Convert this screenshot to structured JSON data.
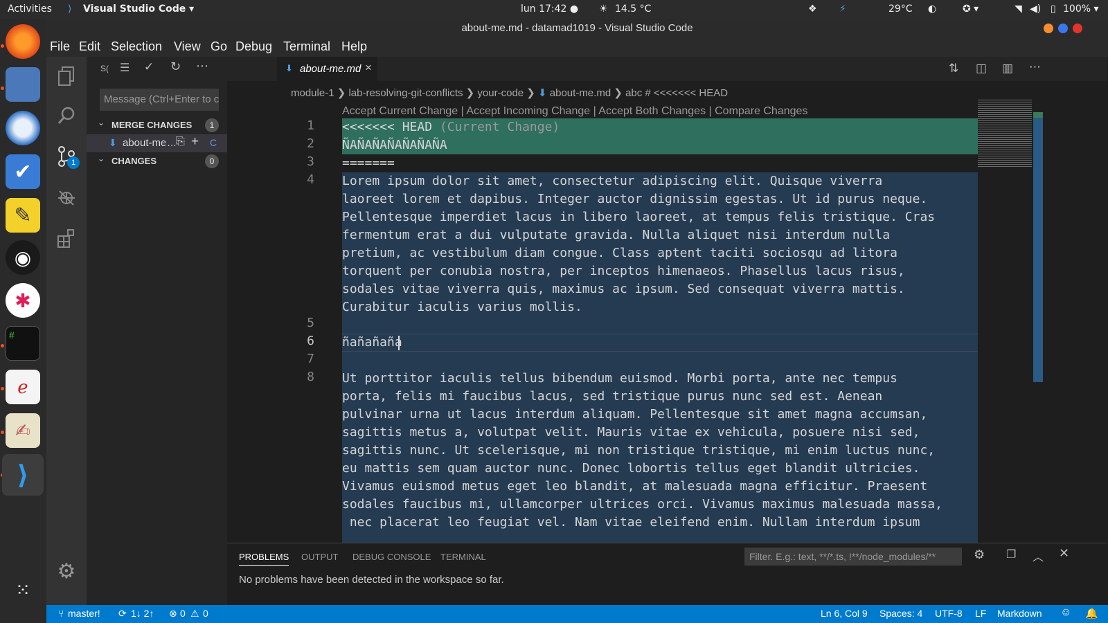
{
  "topbar": {
    "activities": "Activities",
    "app": "Visual Studio Code ▾",
    "clock": "lun 17:42 ●",
    "weather": "14.5 °C",
    "temp": "29°C",
    "battery": "100% ▾"
  },
  "window": {
    "title": "about-me.md - datamad1019 - Visual Studio Code"
  },
  "menu": [
    "File",
    "Edit",
    "Selection",
    "View",
    "Go",
    "Debug",
    "Terminal",
    "Help"
  ],
  "sidebar": {
    "header_abbrev": "S(",
    "commit_placeholder": "Message (Ctrl+Enter to commit)",
    "merge_section": "MERGE CHANGES",
    "merge_count": "1",
    "merge_file": "about-me.md",
    "merge_status": "C",
    "changes_section": "CHANGES",
    "changes_count": "0",
    "badge": "1"
  },
  "tab": {
    "label": "about-me.md"
  },
  "breadcrumb": [
    "module-1",
    "lab-resolving-git-conflicts",
    "your-code",
    "about-me.md",
    "abc # <<<<<<< HEAD"
  ],
  "codelens": "Accept Current Change | Accept Incoming Change | Accept Both Changes | Compare Changes",
  "line_numbers": [
    "1",
    "2",
    "3",
    "4",
    "5",
    "6",
    "7",
    "8"
  ],
  "code": {
    "l1_head": "<<<<<<< HEAD",
    "l1_tag": " (Current Change)",
    "l2": "ÑAÑAÑAÑAÑAÑAÑA",
    "l3": "=======",
    "l4": "Lorem ipsum dolor sit amet, consectetur adipiscing elit. Quisque viverra\nlaoreet lorem et dapibus. Integer auctor dignissim egestas. Ut id purus neque.\nPellentesque imperdiet lacus in libero laoreet, at tempus felis tristique. Cras\nfermentum erat a dui vulputate gravida. Nulla aliquet nisi interdum nulla\npretium, ac vestibulum diam congue. Class aptent taciti sociosqu ad litora\ntorquent per conubia nostra, per inceptos himenaeos. Phasellus lacus risus,\nsodales vitae viverra quis, maximus ac ipsum. Sed consequat viverra mattis.\nCurabitur iaculis varius mollis.",
    "l6": "ñañañaña",
    "l8": "Ut porttitor iaculis tellus bibendum euismod. Morbi porta, ante nec tempus\nporta, felis mi faucibus lacus, sed tristique purus nunc sed est. Aenean\npulvinar urna ut lacus interdum aliquam. Pellentesque sit amet magna accumsan,\nsagittis metus a, volutpat velit. Mauris vitae ex vehicula, posuere nisi sed,\nsagittis nunc. Ut scelerisque, mi non tristique tristique, mi enim luctus nunc,\neu mattis sem quam auctor nunc. Donec lobortis tellus eget blandit ultricies.\nVivamus euismod metus eget leo blandit, at malesuada magna efficitur. Praesent\nsodales faucibus mi, ullamcorper ultrices orci. Vivamus maximus malesuada massa,\n nec placerat leo feugiat vel. Nam vitae eleifend enim. Nullam interdum ipsum"
  },
  "panel": {
    "tabs": [
      "PROBLEMS",
      "OUTPUT",
      "DEBUG CONSOLE",
      "TERMINAL"
    ],
    "filter_placeholder": "Filter. E.g.: text, **/*.ts, !**/node_modules/**",
    "message": "No problems have been detected in the workspace so far."
  },
  "status": {
    "branch": "master!",
    "sync": "1↓ 2↑",
    "errors": "0",
    "warnings": "0",
    "position": "Ln 6, Col 9",
    "spaces": "Spaces: 4",
    "encoding": "UTF-8",
    "eol": "LF",
    "language": "Markdown"
  },
  "colors": {
    "current_change": "#2f6f5e",
    "incoming_change": "#253b52",
    "accent": "#007acc"
  }
}
